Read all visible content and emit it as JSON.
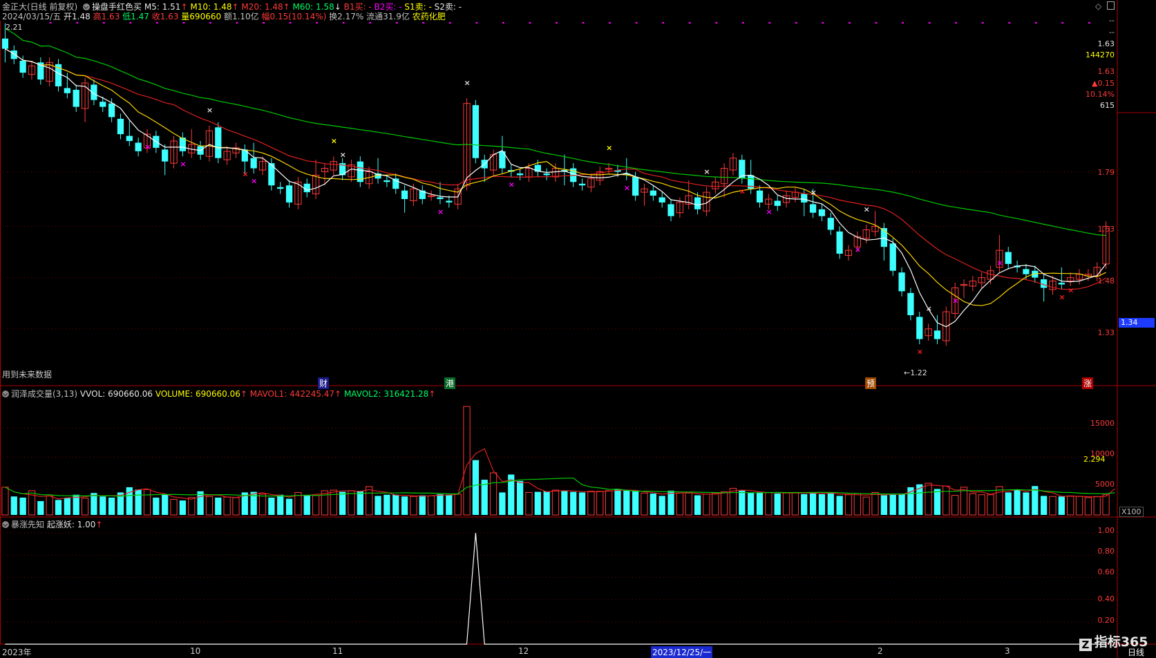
{
  "header": {
    "stock": "金正大(日线 前复权)",
    "formula": "操盘手红色买",
    "m5": "M5: 1.51",
    "m10": "M10: 1.48",
    "m20": "M20: 1.48",
    "m60": "M60: 1.58",
    "b1": "B1买: -",
    "b2": "B2买: -",
    "s1": "S1卖: -",
    "s2": "S2卖: -",
    "date": "2024/03/15/五",
    "open": "开1.48",
    "high": "高1.63",
    "low": "低1.47",
    "close": "收1.63",
    "vol": "量690660",
    "amount": "额1.10亿",
    "change": "幅0.15(10.14%)",
    "turnover": "换2.17%",
    "float": "流通31.9亿",
    "sector": "农药化肥"
  },
  "main_panel": {
    "high_label": "2.21",
    "low_label": "←1.22",
    "note": "用到未来数据",
    "price_ticks": [
      "1.79",
      "1.63",
      "1.48",
      "1.33"
    ],
    "current_price_tag": "1.34",
    "events": [
      "财",
      "港",
      "预",
      "涨"
    ]
  },
  "side_info": {
    "dash1": "--",
    "dash2": "--",
    "price": "1.63",
    "volume": "144270",
    "price2": "1.63",
    "change": "▲0.15",
    "pct": "10.14%",
    "amount": "615"
  },
  "volume_panel": {
    "title": "润泽成交量(3,13)",
    "vvol": "VVOL: 690660.06",
    "volume": "VOLUME: 690660.06",
    "mavol1": "MAVOL1: 442245.47",
    "mavol2": "MAVOL2: 316421.28",
    "ticks": [
      "15000",
      "10000",
      "5000"
    ],
    "unit": "X100",
    "side_value": "2.294"
  },
  "indicator_panel": {
    "title": "暴涨先知",
    "value": "起涨妖: 1.00",
    "ticks": [
      "1.00",
      "0.80",
      "0.60",
      "0.40",
      "0.20"
    ]
  },
  "x_axis": {
    "labels": [
      "2023年",
      "10",
      "11",
      "12",
      "2023/12/25/一",
      "2",
      "3"
    ],
    "period": "日线",
    "brand": "指标365"
  },
  "colors": {
    "up": "#ff3a3a",
    "down": "#3dffff",
    "ma5": "#ffffff",
    "ma10": "#ffd700",
    "ma20": "#e02020",
    "ma60": "#00cc00"
  },
  "chart_data": {
    "type": "candlestick",
    "title": "金正大(日线 前复权)",
    "ylim": [
      1.2,
      2.22
    ],
    "x_labels": [
      "2023年",
      "10",
      "11",
      "12",
      "2",
      "3"
    ],
    "close": [
      2.15,
      2.12,
      2.08,
      2.1,
      2.06,
      2.11,
      2.04,
      2.02,
      1.98,
      2.05,
      2.0,
      1.98,
      1.95,
      1.9,
      1.88,
      1.85,
      1.9,
      1.86,
      1.82,
      1.88,
      1.85,
      1.87,
      1.84,
      1.91,
      1.83,
      1.85,
      1.86,
      1.82,
      1.8,
      1.82,
      1.75,
      1.74,
      1.7,
      1.76,
      1.73,
      1.78,
      1.8,
      1.82,
      1.78,
      1.81,
      1.76,
      1.79,
      1.77,
      1.76,
      1.74,
      1.71,
      1.74,
      1.71,
      1.72,
      1.71,
      1.7,
      1.74,
      1.99,
      1.83,
      1.8,
      1.84,
      1.8,
      1.79,
      1.78,
      1.8,
      1.79,
      1.78,
      1.8,
      1.79,
      1.76,
      1.75,
      1.77,
      1.79,
      1.8,
      1.79,
      1.78,
      1.72,
      1.74,
      1.72,
      1.7,
      1.66,
      1.7,
      1.72,
      1.68,
      1.73,
      1.76,
      1.8,
      1.83,
      1.77,
      1.74,
      1.7,
      1.71,
      1.69,
      1.72,
      1.73,
      1.7,
      1.67,
      1.66,
      1.62,
      1.55,
      1.56,
      1.6,
      1.62,
      1.63,
      1.57,
      1.5,
      1.44,
      1.37,
      1.3,
      1.33,
      1.3,
      1.38,
      1.45,
      1.46,
      1.47,
      1.48,
      1.5,
      1.56,
      1.52,
      1.51,
      1.49,
      1.48,
      1.45,
      1.47,
      1.46,
      1.48,
      1.49,
      1.49,
      1.51,
      1.63
    ],
    "volume": [
      4800,
      3200,
      3000,
      4200,
      2400,
      3300,
      2600,
      3000,
      3500,
      2900,
      3800,
      3200,
      3000,
      3900,
      4800,
      4400,
      4400,
      3000,
      3600,
      2700,
      2500,
      3000,
      4100,
      3200,
      3000,
      3100,
      3000,
      3900,
      4000,
      3600,
      3000,
      3500,
      2800,
      3900,
      3400,
      3400,
      4200,
      4300,
      4000,
      4200,
      4100,
      4900,
      3300,
      3500,
      3500,
      3200,
      3200,
      3400,
      3300,
      3600,
      3500,
      3600,
      18800,
      9500,
      6100,
      7300,
      3900,
      7000,
      5900,
      3900,
      4000,
      4100,
      4300,
      4200,
      4000,
      3900,
      4100,
      4100,
      4200,
      4500,
      4200,
      4100,
      3800,
      3700,
      3300,
      4200,
      3800,
      3800,
      3400,
      3600,
      3800,
      4000,
      4600,
      4300,
      3800,
      3900,
      3900,
      3700,
      3800,
      3900,
      3600,
      3900,
      3600,
      3900,
      3300,
      3500,
      3700,
      3100,
      3900,
      3400,
      3500,
      3700,
      4800,
      5300,
      5500,
      4500,
      5000,
      3400,
      4800,
      3700,
      3500,
      3500,
      4900,
      3900,
      4400,
      3900,
      5000,
      3300,
      3200,
      3200,
      3300,
      3200,
      3000,
      3200,
      3500,
      6900
    ],
    "indicator": [
      {
        "x_index": 53,
        "value": 1.0
      },
      {
        "x_index": 125,
        "value": 1.0
      }
    ]
  }
}
